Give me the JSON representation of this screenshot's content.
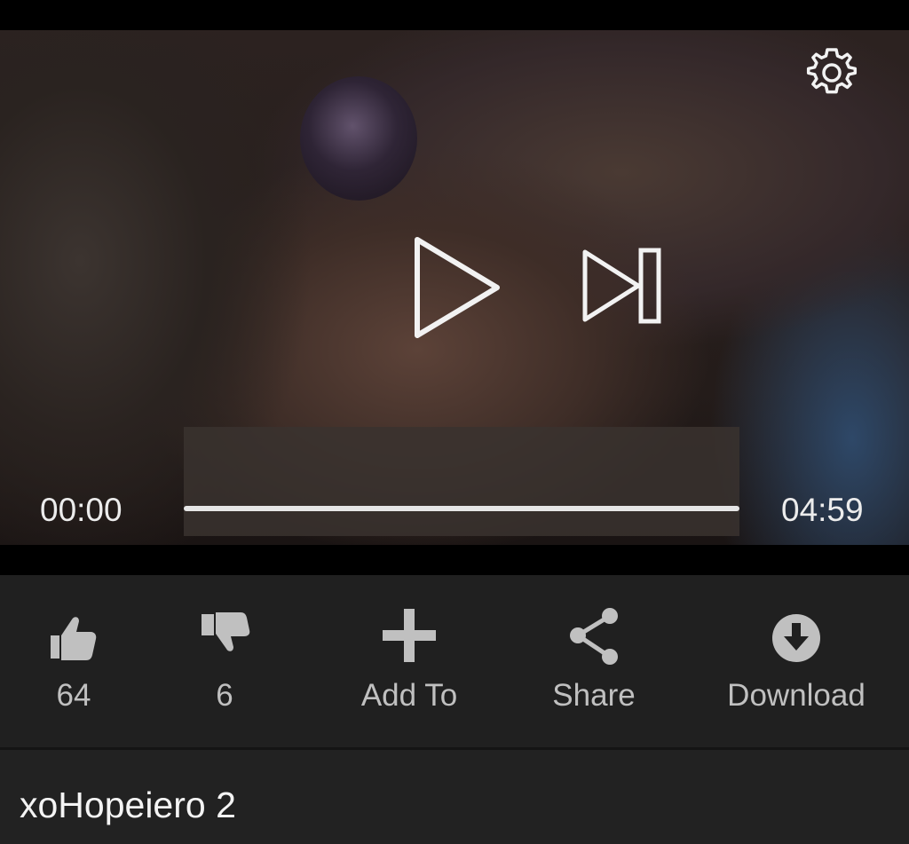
{
  "player": {
    "current_time": "00:00",
    "total_time": "04:59",
    "progress": 0
  },
  "actions": {
    "like": {
      "label": "64",
      "icon": "thumbs-up-icon"
    },
    "dislike": {
      "label": "6",
      "icon": "thumbs-down-icon"
    },
    "add_to": {
      "label": "Add To",
      "icon": "plus-icon"
    },
    "share": {
      "label": "Share",
      "icon": "share-icon"
    },
    "download": {
      "label": "Download",
      "icon": "download-icon"
    }
  },
  "video": {
    "title": "xoHopeiero 2"
  },
  "colors": {
    "icon": "#c0c0c0",
    "action_bar": "#202020",
    "title_bar": "#222222"
  }
}
